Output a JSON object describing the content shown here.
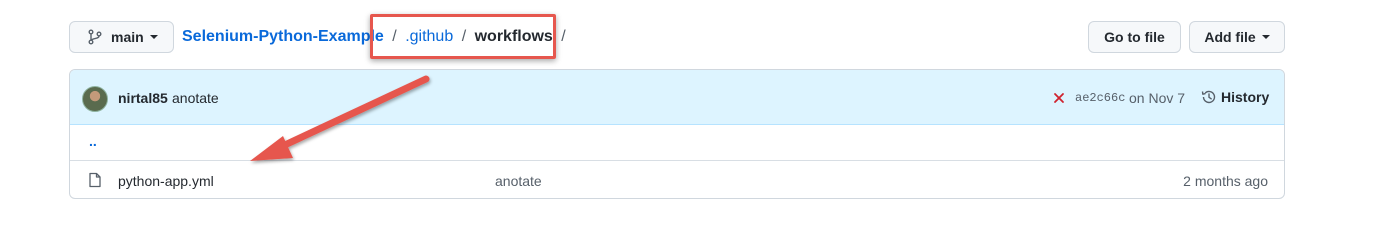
{
  "branch": {
    "label": "main",
    "icon": "git-branch-icon"
  },
  "breadcrumb": {
    "repo": "Selenium-Python-Example",
    "separator": "/",
    "folder": ".github",
    "current": "workflows",
    "trailing": "/"
  },
  "actions": {
    "go_to_file": "Go to file",
    "add_file": "Add file"
  },
  "commit": {
    "author": "nirtal85",
    "message": "anotate",
    "status_icon": "x-icon",
    "sha": "ae2c66c",
    "date": "on Nov 7",
    "history_label": "History"
  },
  "files": [
    {
      "up": ".."
    },
    {
      "name": "python-app.yml",
      "message": "anotate",
      "age": "2 months ago",
      "icon": "file-icon"
    }
  ],
  "annotation": {
    "color": "#e6574e",
    "type": "arrow-and-box"
  },
  "colors": {
    "accent": "#0969da",
    "commit_bar": "#ddf4ff",
    "error": "#cf222e"
  }
}
